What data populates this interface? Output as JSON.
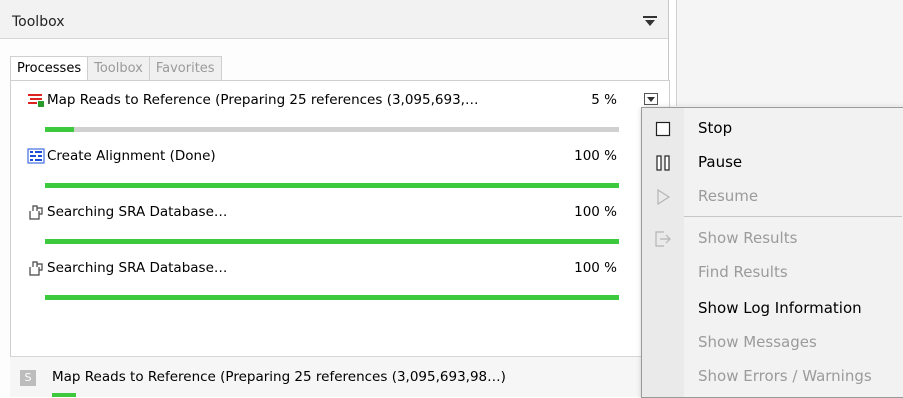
{
  "toolbox": {
    "title": "Toolbox",
    "tabs": [
      {
        "label": "Processes",
        "active": true
      },
      {
        "label": "Toolbox",
        "active": false
      },
      {
        "label": "Favorites",
        "active": false
      }
    ]
  },
  "processes": [
    {
      "name": "Map Reads to Reference (Preparing 25 references (3,095,693,…",
      "percent_label": "5 %",
      "progress": 0.05,
      "icon": "map-reads-icon"
    },
    {
      "name": "Create Alignment (Done)",
      "percent_label": "100 %",
      "progress": 1.0,
      "icon": "alignment-icon"
    },
    {
      "name": "Searching SRA Database…",
      "percent_label": "100 %",
      "progress": 1.0,
      "icon": "search-sra-icon"
    },
    {
      "name": "Searching SRA Database…",
      "percent_label": "100 %",
      "progress": 1.0,
      "icon": "search-sra-icon"
    }
  ],
  "status_bar": {
    "badge": "S",
    "text": "Map Reads to Reference (Preparing 25 references (3,095,693,98…)"
  },
  "context_menu": {
    "items": [
      {
        "label": "Stop",
        "enabled": true,
        "icon": "stop-icon"
      },
      {
        "label": "Pause",
        "enabled": true,
        "icon": "pause-icon"
      },
      {
        "label": "Resume",
        "enabled": false,
        "icon": "play-icon"
      },
      {
        "label": "Show Results",
        "enabled": false,
        "icon": "show-results-icon"
      },
      {
        "label": "Find Results",
        "enabled": false
      },
      {
        "label": "Show Log Information",
        "enabled": true
      },
      {
        "label": "Show Messages",
        "enabled": false
      },
      {
        "label": "Show Errors / Warnings",
        "enabled": false
      }
    ]
  },
  "colors": {
    "progress": "#3dc93d",
    "progress_track": "#d0d0d0",
    "disabled_text": "#9b9b9b"
  }
}
